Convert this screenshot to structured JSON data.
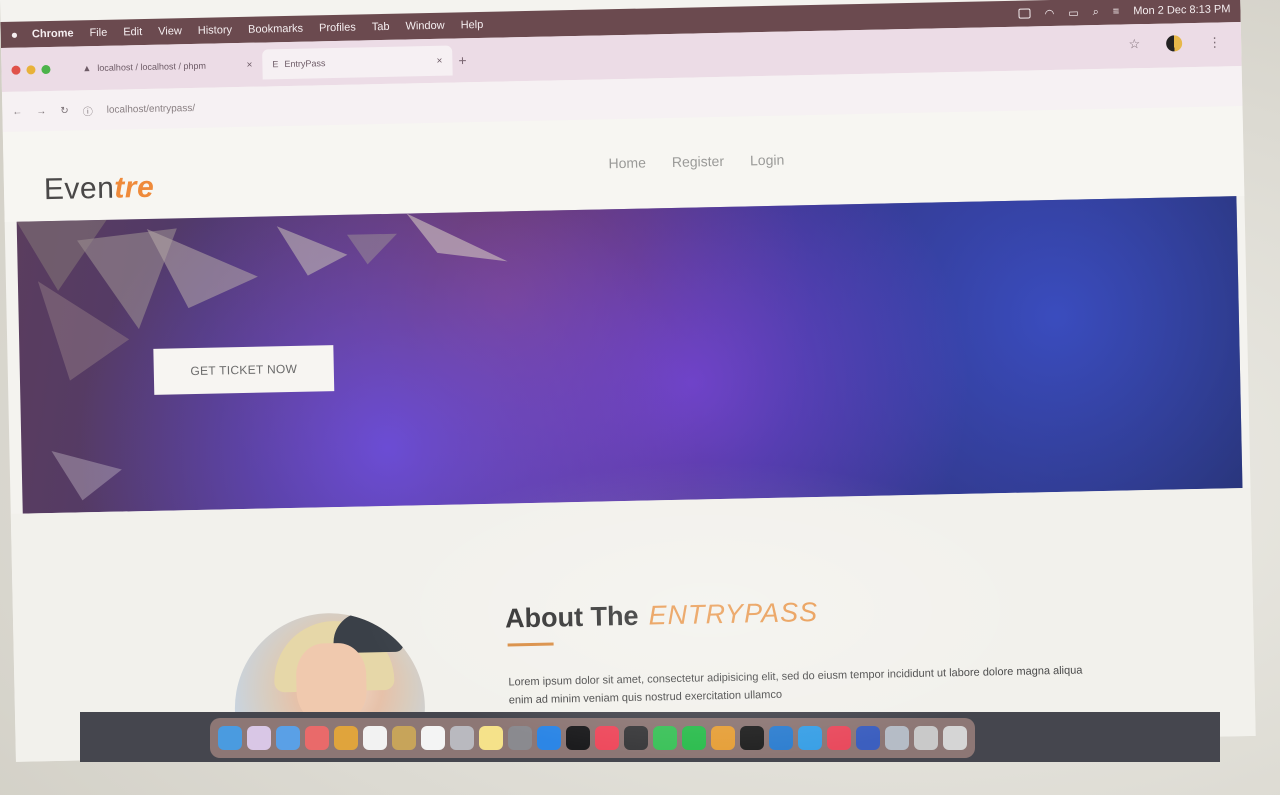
{
  "menubar": {
    "app": "Chrome",
    "items": [
      "File",
      "Edit",
      "View",
      "History",
      "Bookmarks",
      "Profiles",
      "Tab",
      "Window",
      "Help"
    ],
    "clock": "Mon 2 Dec  8:13 PM"
  },
  "browser": {
    "tabs": [
      {
        "label": "localhost / localhost / phpm",
        "active": false
      },
      {
        "label": "EntryPass",
        "active": true
      }
    ],
    "new_tab": "+",
    "url": "localhost/entrypass/"
  },
  "site": {
    "logo_main": "Even",
    "logo_accent": "tre",
    "nav": [
      "Home",
      "Register",
      "Login"
    ],
    "cta": "GET TICKET NOW",
    "about_title_prefix": "About The",
    "about_title_highlight": "ENTRYPASS",
    "about_text": "Lorem ipsum dolor sit amet, consectetur adipisicing elit, sed do eiusm tempor incididunt ut labore dolore magna aliqua enim ad minim veniam quis nostrud exercitation ullamco"
  },
  "colors": {
    "accent": "#ef8a3a",
    "menubar": "#6b4a4f",
    "tabbar": "#ecdce6"
  },
  "dock": {
    "icons": [
      "finder-icon",
      "launchpad-icon",
      "mail-icon",
      "photos-icon",
      "chrome-icon",
      "calendar-icon",
      "notes-icon",
      "reminders-icon",
      "contacts-icon",
      "notes-icon",
      "settings-icon",
      "app-store-icon",
      "apple-tv-icon",
      "music-icon",
      "podcasts-icon",
      "facetime-icon",
      "messages-icon",
      "chrome-icon",
      "terminal-icon",
      "vscode-icon",
      "safari-icon",
      "music-app-icon",
      "xcode-icon",
      "finder-window-icon",
      "downloads-icon",
      "trash-icon"
    ]
  }
}
